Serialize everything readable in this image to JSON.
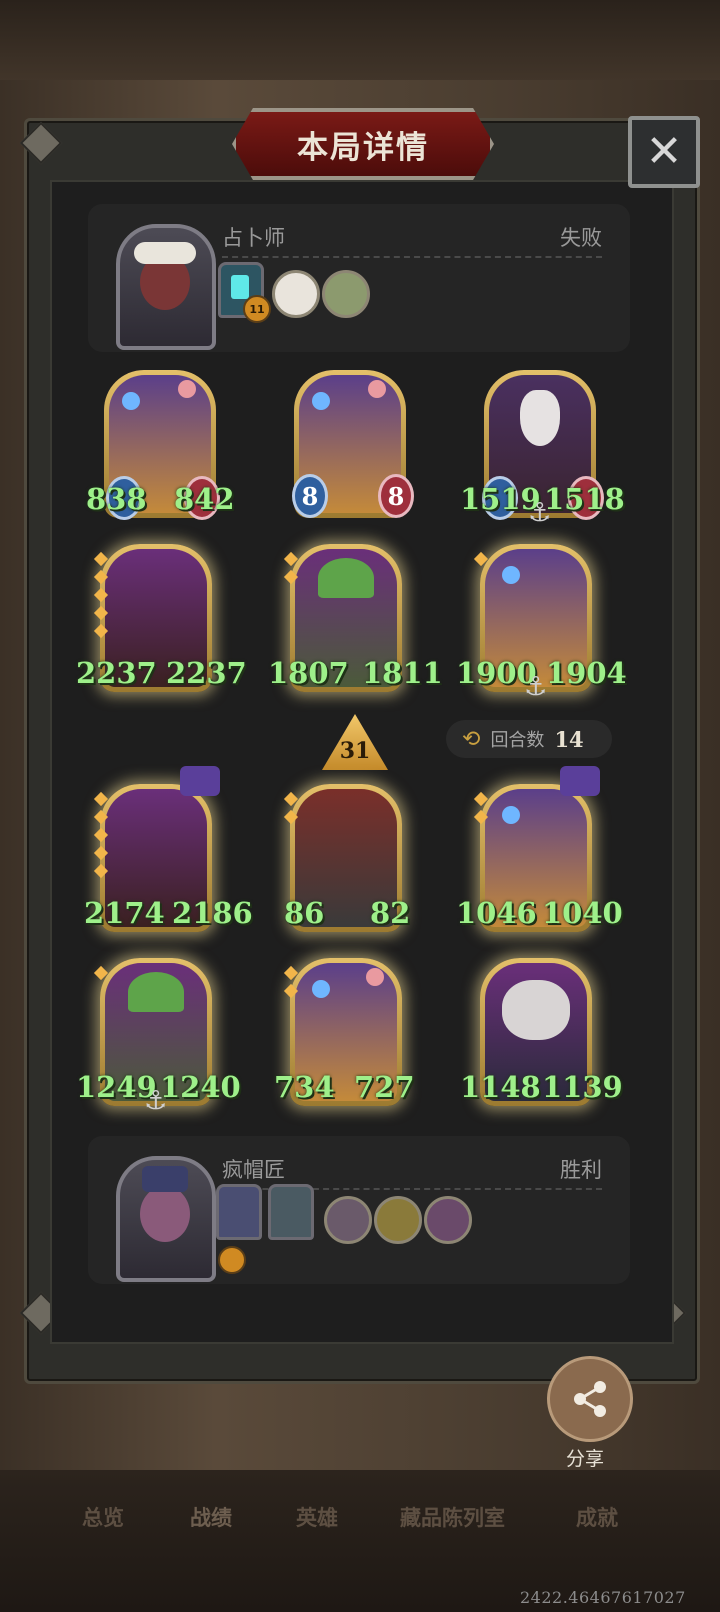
{
  "title": "本局详情",
  "close_icon": "close-icon",
  "opponent": {
    "name": "占卜师",
    "result": "失败",
    "buff_level": "11",
    "board": [
      {
        "attack": "838",
        "health": "842",
        "golden": false
      },
      {
        "attack": "8",
        "health": "8",
        "golden": false
      },
      {
        "attack": "1519",
        "health": "1518",
        "golden": false
      },
      {
        "attack": "2237",
        "health": "2237",
        "golden": true
      },
      {
        "attack": "1807",
        "health": "1811",
        "golden": true
      },
      {
        "attack": "1900",
        "health": "1904",
        "golden": true
      }
    ]
  },
  "player": {
    "name": "疯帽匠",
    "result": "胜利",
    "board": [
      {
        "attack": "2174",
        "health": "2186",
        "golden": true
      },
      {
        "attack": "86",
        "health": "82",
        "golden": true
      },
      {
        "attack": "1046",
        "health": "1040",
        "golden": true
      },
      {
        "attack": "1249",
        "health": "1240",
        "golden": true
      },
      {
        "attack": "734",
        "health": "727",
        "golden": true
      },
      {
        "attack": "1148",
        "health": "1139",
        "golden": true
      }
    ]
  },
  "tavern_tier": "31",
  "turns": {
    "label": "回合数",
    "value": "14",
    "icon": "refresh-icon"
  },
  "share": {
    "label": "分享",
    "icon": "share-icon"
  },
  "nav_tabs": [
    "总览",
    "战绩",
    "英雄",
    "藏品陈列室",
    "成就"
  ],
  "coords_text": "2422.46467617027",
  "colors": {
    "stat_text": "#9ef08a",
    "title_plate": "#7a1a16",
    "panel": "#1e1e1e"
  }
}
